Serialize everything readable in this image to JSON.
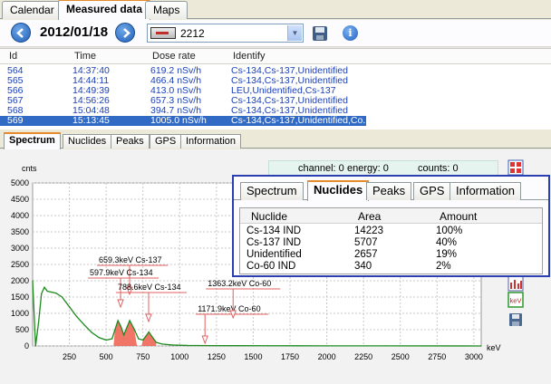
{
  "top_tabs": [
    "Calendar",
    "Measured data",
    "Maps"
  ],
  "toolbar": {
    "date": "2012/01/18",
    "device": "2212",
    "info_glyph": "i"
  },
  "grid": {
    "columns": [
      "Id",
      "Time",
      "Dose rate",
      "Identify"
    ],
    "rows": [
      {
        "id": "564",
        "time": "14:37:40",
        "dose": "619.2 nSv/h",
        "identify": "Cs-134,Cs-137,Unidentified"
      },
      {
        "id": "565",
        "time": "14:44:11",
        "dose": "466.4 nSv/h",
        "identify": "Cs-134,Cs-137,Unidentified"
      },
      {
        "id": "566",
        "time": "14:49:39",
        "dose": "413.0 nSv/h",
        "identify": "LEU,Unidentified,Cs-137"
      },
      {
        "id": "567",
        "time": "14:56:26",
        "dose": "657.3 nSv/h",
        "identify": "Cs-134,Cs-137,Unidentified"
      },
      {
        "id": "568",
        "time": "15:04:48",
        "dose": "394.7 nSv/h",
        "identify": "Cs-134,Cs-137,Unidentified"
      },
      {
        "id": "569",
        "time": "15:13:45",
        "dose": "1005.0 nSv/h",
        "identify": "Cs-134,Cs-137,Unidentified,Co..."
      }
    ]
  },
  "lower_tabs": [
    "Spectrum",
    "Nuclides",
    "Peaks",
    "GPS",
    "Information"
  ],
  "readout": {
    "channel": "channel: 0",
    "energy": "energy:  0",
    "counts": "counts:  0"
  },
  "popup": {
    "tabs": [
      "Spectrum",
      "Nuclides",
      "Peaks",
      "GPS",
      "Information"
    ],
    "columns": [
      "Nuclide",
      "Area",
      "Amount"
    ],
    "rows": [
      {
        "nuclide": "Cs-134 IND",
        "area": "14223",
        "amount": "100%"
      },
      {
        "nuclide": "Cs-137 IND",
        "area": "5707",
        "amount": "40%"
      },
      {
        "nuclide": "Unidentified",
        "area": "2657",
        "amount": "19%"
      },
      {
        "nuclide": "Co-60 IND",
        "area": "340",
        "amount": "2%"
      }
    ]
  },
  "side_buttons": {
    "kev_label": "keV"
  },
  "chart_data": {
    "type": "line",
    "ylabel": "cnts",
    "xlabel": "keV",
    "xlim": [
      0,
      3050
    ],
    "ylim": [
      0,
      5000
    ],
    "xticks": [
      "250",
      "500",
      "750",
      "1000",
      "1250",
      "1500",
      "1750",
      "2000",
      "2250",
      "2500",
      "2750",
      "3000"
    ],
    "yticks": [
      "0",
      "500",
      "1000",
      "1500",
      "2000",
      "2500",
      "3000",
      "3500",
      "4000",
      "4500",
      "5000"
    ],
    "x": [
      0,
      20,
      40,
      60,
      80,
      100,
      130,
      160,
      200,
      250,
      300,
      350,
      400,
      450,
      500,
      540,
      560,
      580,
      600,
      620,
      640,
      660,
      690,
      720,
      750,
      770,
      790,
      810,
      840,
      880,
      950,
      1050,
      1200,
      1400,
      1600,
      1800,
      2000,
      2400,
      2800,
      3050
    ],
    "y": [
      2000,
      0,
      700,
      1600,
      1800,
      1680,
      1650,
      1620,
      1500,
      1200,
      900,
      650,
      420,
      260,
      180,
      220,
      500,
      780,
      600,
      340,
      560,
      780,
      520,
      220,
      180,
      300,
      430,
      300,
      110,
      60,
      30,
      15,
      10,
      8,
      6,
      5,
      4,
      3,
      2,
      1
    ],
    "peak_annotations": [
      {
        "label": "659.3keV Cs-137",
        "energy": 659.3
      },
      {
        "label": "597.9keV Cs-134",
        "energy": 597.9
      },
      {
        "label": "788.6keV Cs-134",
        "energy": 788.6
      },
      {
        "label": "1171.9keV Co-60",
        "energy": 1171.9
      },
      {
        "label": "1363.2keV Co-60",
        "energy": 1363.2
      }
    ],
    "grid": true,
    "series_color": "#1e8a1e",
    "peak_fill_color": "#ee6655"
  },
  "colors": {
    "accent": "#316ac5",
    "tab_highlight": "#e68b2c",
    "popup_border": "#2b3fb0"
  }
}
